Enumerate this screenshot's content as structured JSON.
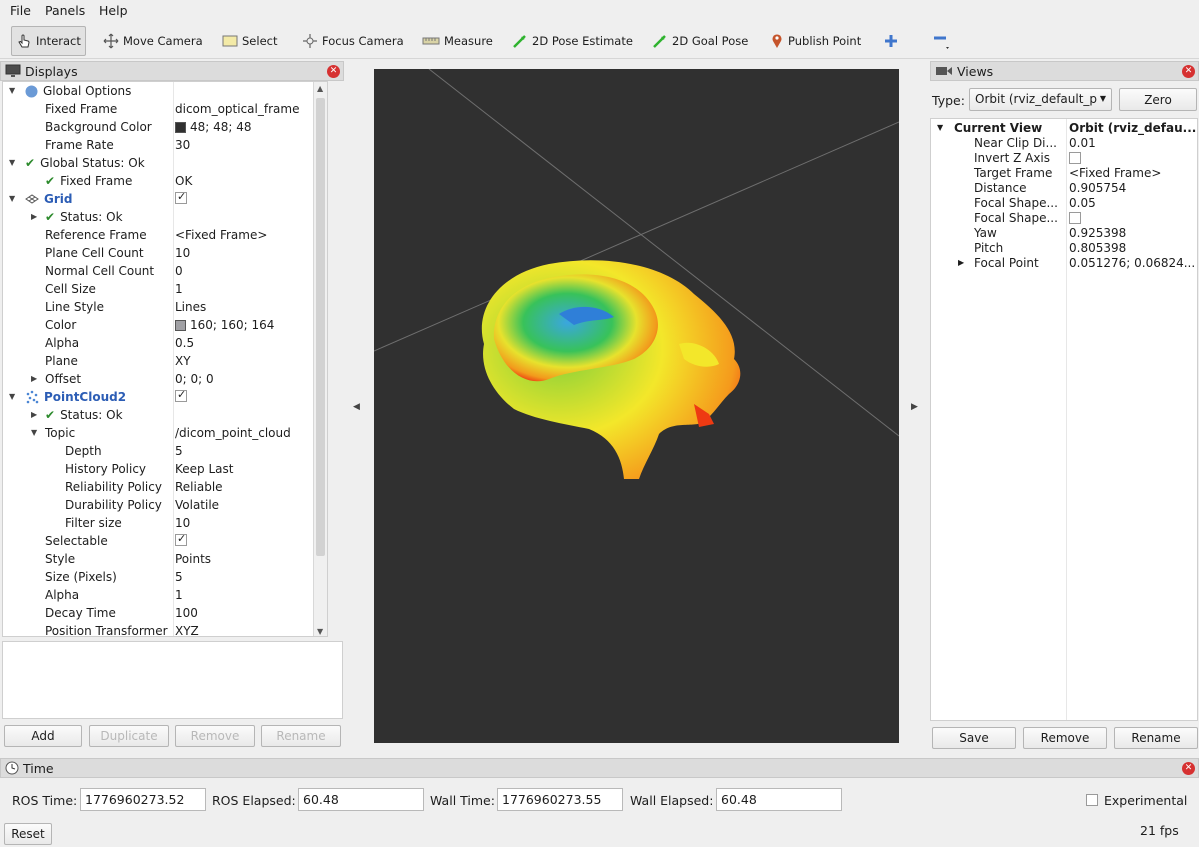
{
  "menu": [
    "File",
    "Panels",
    "Help"
  ],
  "toolbar": {
    "tools": [
      "Interact",
      "Move Camera",
      "Select",
      "Focus Camera",
      "Measure",
      "2D Pose Estimate",
      "2D Goal Pose",
      "Publish Point"
    ]
  },
  "displays": {
    "title": "Displays",
    "rows": [
      {
        "label": "Global Options",
        "value": ""
      },
      {
        "label": "Fixed Frame",
        "value": "dicom_optical_frame"
      },
      {
        "label": "Background Color",
        "value": "48; 48; 48"
      },
      {
        "label": "Frame Rate",
        "value": "30"
      },
      {
        "label": "Global Status: Ok",
        "value": ""
      },
      {
        "label": "Fixed Frame",
        "value": "OK"
      },
      {
        "label": "Grid",
        "value": ""
      },
      {
        "label": "Status: Ok",
        "value": ""
      },
      {
        "label": "Reference Frame",
        "value": "<Fixed Frame>"
      },
      {
        "label": "Plane Cell Count",
        "value": "10"
      },
      {
        "label": "Normal Cell Count",
        "value": "0"
      },
      {
        "label": "Cell Size",
        "value": "1"
      },
      {
        "label": "Line Style",
        "value": "Lines"
      },
      {
        "label": "Color",
        "value": "160; 160; 164"
      },
      {
        "label": "Alpha",
        "value": "0.5"
      },
      {
        "label": "Plane",
        "value": "XY"
      },
      {
        "label": "Offset",
        "value": "0; 0; 0"
      },
      {
        "label": "PointCloud2",
        "value": ""
      },
      {
        "label": "Status: Ok",
        "value": ""
      },
      {
        "label": "Topic",
        "value": "/dicom_point_cloud"
      },
      {
        "label": "Depth",
        "value": "5"
      },
      {
        "label": "History Policy",
        "value": "Keep Last"
      },
      {
        "label": "Reliability Policy",
        "value": "Reliable"
      },
      {
        "label": "Durability Policy",
        "value": "Volatile"
      },
      {
        "label": "Filter size",
        "value": "10"
      },
      {
        "label": "Selectable",
        "value": ""
      },
      {
        "label": "Style",
        "value": "Points"
      },
      {
        "label": "Size (Pixels)",
        "value": "5"
      },
      {
        "label": "Alpha",
        "value": "1"
      },
      {
        "label": "Decay Time",
        "value": "100"
      },
      {
        "label": "Position Transformer",
        "value": "XYZ"
      }
    ],
    "colors": {
      "background_swatch": "#303030",
      "grid_swatch": "#a0a0a4"
    },
    "buttons": {
      "add": "Add",
      "duplicate": "Duplicate",
      "remove": "Remove",
      "rename": "Rename"
    }
  },
  "views": {
    "title": "Views",
    "type_label": "Type:",
    "type_value": "Orbit (rviz_default_p",
    "zero": "Zero",
    "current_view": {
      "label": "Current View",
      "value": "Orbit (rviz_defau..."
    },
    "rows": [
      {
        "label": "Near Clip Di...",
        "value": "0.01"
      },
      {
        "label": "Invert Z Axis",
        "value": ""
      },
      {
        "label": "Target Frame",
        "value": "<Fixed Frame>"
      },
      {
        "label": "Distance",
        "value": "0.905754"
      },
      {
        "label": "Focal Shape...",
        "value": "0.05"
      },
      {
        "label": "Focal Shape...",
        "value": ""
      },
      {
        "label": "Yaw",
        "value": "0.925398"
      },
      {
        "label": "Pitch",
        "value": "0.805398"
      },
      {
        "label": "Focal Point",
        "value": "0.051276; 0.06824..."
      }
    ],
    "buttons": {
      "save": "Save",
      "remove": "Remove",
      "rename": "Rename"
    }
  },
  "time": {
    "title": "Time",
    "ros_time_label": "ROS Time:",
    "ros_time": "1776960273.52",
    "ros_elapsed_label": "ROS Elapsed:",
    "ros_elapsed": "60.48",
    "wall_time_label": "Wall Time:",
    "wall_time": "1776960273.55",
    "wall_elapsed_label": "Wall Elapsed:",
    "wall_elapsed": "60.48",
    "experimental": "Experimental",
    "reset": "Reset",
    "fps": "21 fps"
  }
}
